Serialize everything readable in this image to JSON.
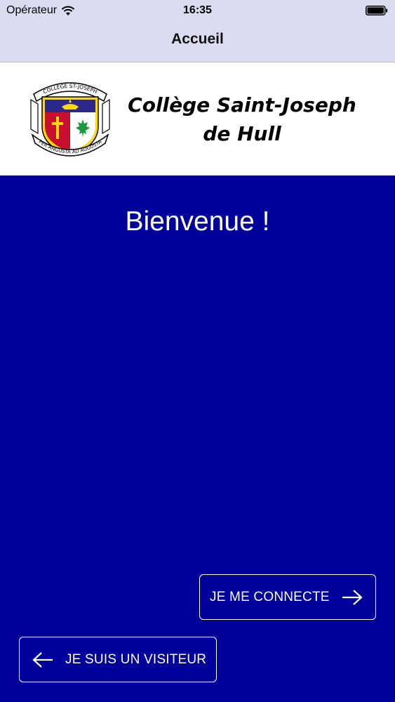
{
  "status_bar": {
    "carrier": "Opérateur",
    "time": "16:35",
    "wifi_icon": "wifi-icon",
    "battery_icon": "battery-icon"
  },
  "nav": {
    "title": "Accueil"
  },
  "header": {
    "school_name_line1": "Collège Saint-Joseph",
    "school_name_line2": "de Hull",
    "crest": {
      "top_ribbon": "COLLÈGE ST-JOSEPH",
      "bottom_ribbon": "PER ANGUSTA AD AUGUSTA"
    }
  },
  "main": {
    "welcome": "Bienvenue !"
  },
  "buttons": {
    "connect_label": "JE ME CONNECTE",
    "visitor_label": "JE SUIS UN VISITEUR"
  },
  "colors": {
    "background": "#01009a",
    "nav_bar": "#dcdcf0",
    "header": "#ffffff"
  }
}
